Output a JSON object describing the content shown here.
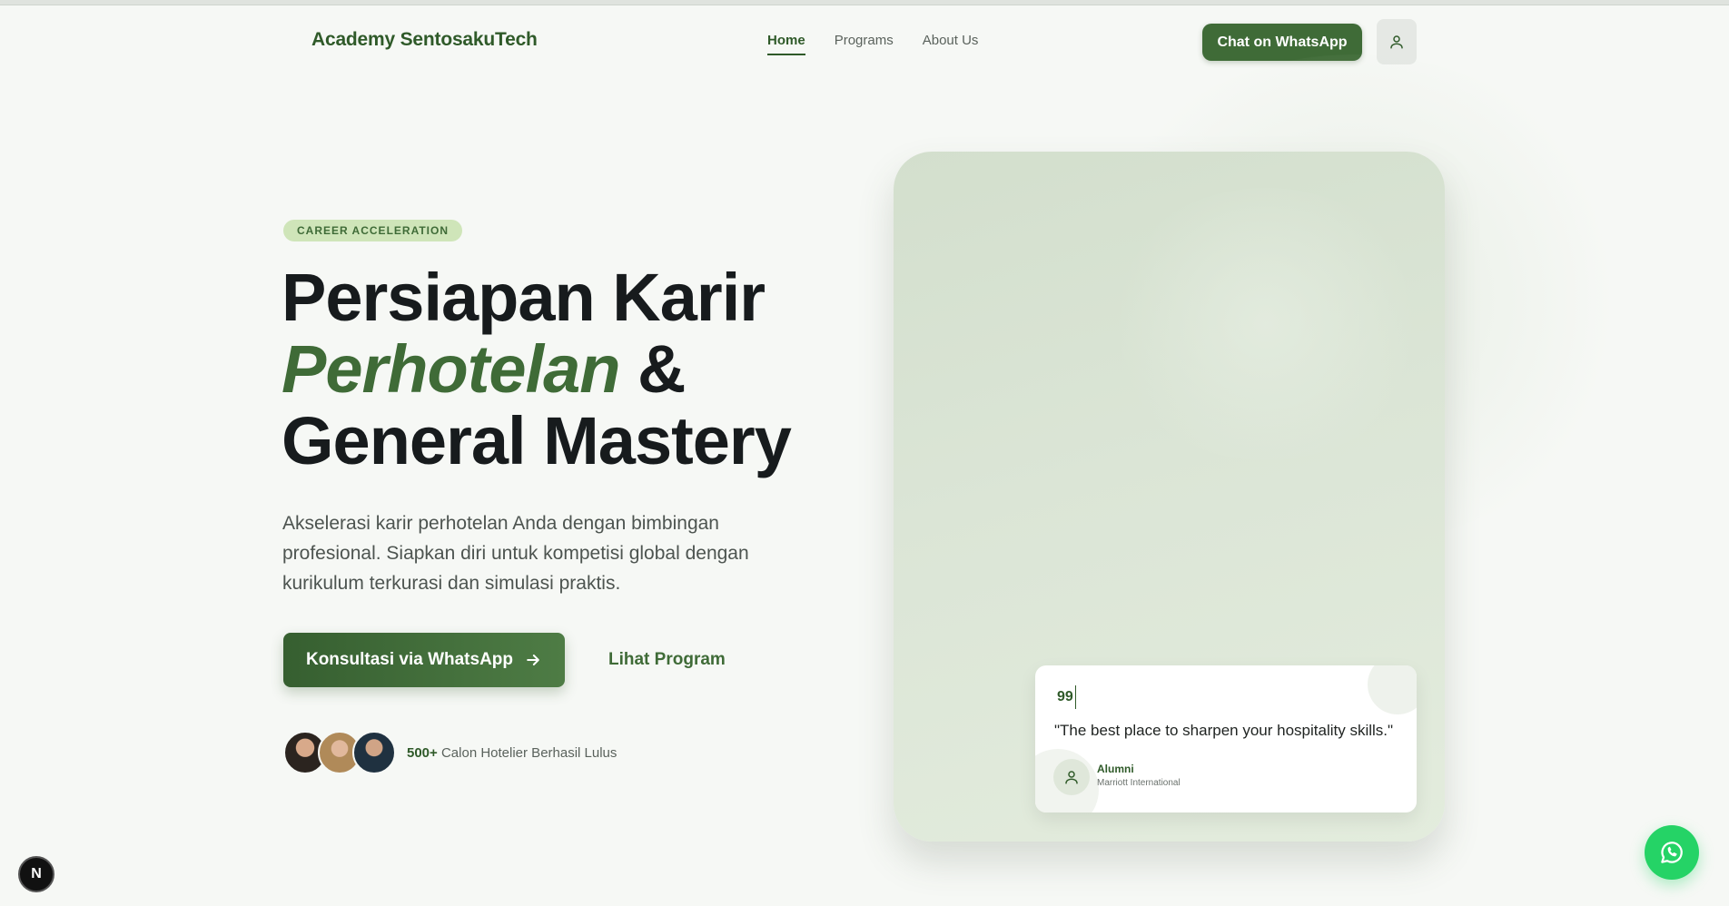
{
  "header": {
    "brand": "Academy SentosakuTech",
    "nav": [
      {
        "label": "Home",
        "active": true
      },
      {
        "label": "Programs",
        "active": false
      },
      {
        "label": "About Us",
        "active": false
      }
    ],
    "cta_label": "Chat on WhatsApp",
    "user_icon": "user-icon"
  },
  "hero": {
    "badge": "CAREER ACCELERATION",
    "title_line1": "Persiapan Karir",
    "title_accent": "Perhotelan",
    "title_amp": "&",
    "title_line3": "General Mastery",
    "description": "Akselerasi karir perhotelan Anda dengan bimbingan profesional. Siapkan diri untuk kompetisi global dengan kurikulum terkurasi dan simulasi praktis.",
    "primary_cta": "Konsultasi via WhatsApp",
    "primary_cta_icon": "arrow-right-icon",
    "secondary_cta": "Lihat Program",
    "graduates_count": "500+",
    "graduates_text": "Calon Hotelier Berhasil Lulus"
  },
  "testimonial": {
    "mark": "99",
    "quote": "\"The best place to sharpen your hospitality skills.\"",
    "name": "Alumni",
    "role": "Marriott International"
  },
  "floating": {
    "whatsapp_icon": "whatsapp-icon",
    "dev_badge": "N"
  },
  "colors": {
    "brand_green": "#3f6b37",
    "badge_bg": "#cfe5b9",
    "whatsapp_green": "#25d366",
    "background": "#f6f8f5"
  }
}
